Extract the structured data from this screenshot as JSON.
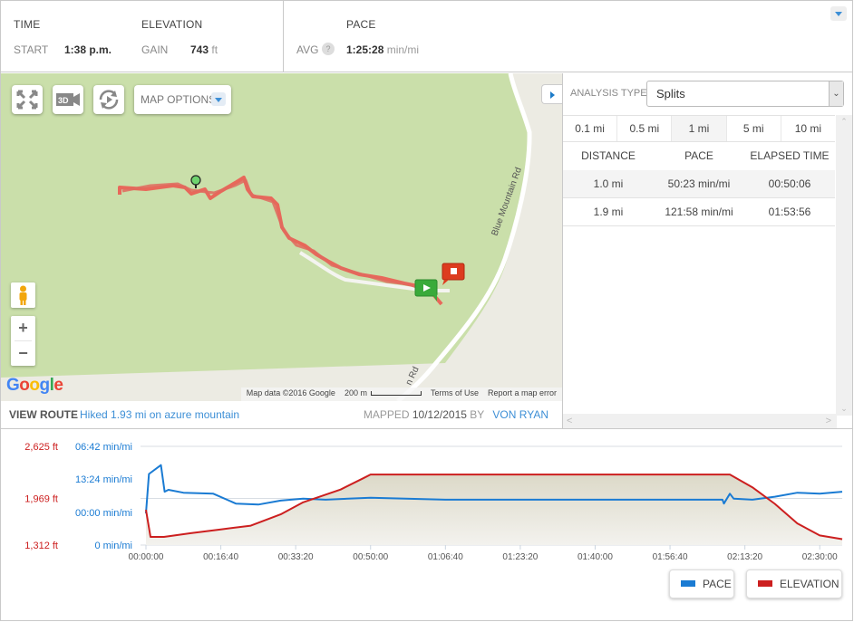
{
  "stats": {
    "time": {
      "label": "TIME",
      "sub": "START",
      "value": "1:38 p.m."
    },
    "elevation": {
      "label": "ELEVATION",
      "sub": "GAIN",
      "value": "743",
      "unit": "ft"
    },
    "pace": {
      "label": "PACE",
      "sub": "AVG",
      "help": "?",
      "value": "1:25:28",
      "unit": "min/mi"
    }
  },
  "map": {
    "controls": {
      "fullscreen_icon": "fullscreen-icon",
      "view3d_icon": "3d-camera-icon",
      "rotate_icon": "rotate-icon",
      "options_label": "MAP OPTIONS"
    },
    "zoom_in": "+",
    "zoom_out": "−",
    "road_label": "Blue Mountain Rd",
    "road_label_2": "n Rd",
    "google": [
      "G",
      "o",
      "o",
      "g",
      "l",
      "e"
    ],
    "footer": {
      "data": "Map data ©2016 Google",
      "scale": "200 m",
      "terms": "Terms of Use",
      "report": "Report a map error"
    }
  },
  "route": {
    "view_label": "VIEW ROUTE",
    "link": "Hiked 1.93 mi on azure mountain",
    "mapped_label": "MAPPED",
    "mapped_date": "10/12/2015",
    "by_label": "BY",
    "author": "VON RYAN"
  },
  "analysis": {
    "type_label": "ANALYSIS TYPE:",
    "type_value": "Splits",
    "tabs": [
      {
        "label": "0.1 mi",
        "active": false
      },
      {
        "label": "0.5 mi",
        "active": false
      },
      {
        "label": "1 mi",
        "active": true
      },
      {
        "label": "5 mi",
        "active": false
      },
      {
        "label": "10 mi",
        "active": false
      }
    ],
    "columns": [
      "DISTANCE",
      "PACE",
      "ELAPSED TIME"
    ],
    "rows": [
      [
        "1.0 mi",
        "50:23 min/mi",
        "00:50:06"
      ],
      [
        "1.9 mi",
        "121:58 min/mi",
        "01:53:56"
      ]
    ]
  },
  "colors": {
    "pace": "#1a7bd3",
    "elevation": "#cc1f1f",
    "link": "#3d8fd6",
    "map_green": "#cadfaa",
    "route": "#e8685a"
  },
  "chart_data": {
    "type": "line",
    "title": "",
    "x_ticks": [
      "00:00:00",
      "00:16:40",
      "00:33:20",
      "00:50:00",
      "01:06:40",
      "01:23:20",
      "01:40:00",
      "01:56:40",
      "02:13:20",
      "02:30:00"
    ],
    "x_range_seconds": [
      0,
      9000
    ],
    "y_left_elevation_ticks": [
      "2,625 ft",
      "1,969 ft",
      "1,312 ft"
    ],
    "y_left_elevation_range": [
      1312,
      2625
    ],
    "y_pace_ticks": [
      "06:42 min/mi",
      "13:24 min/mi",
      "00:00 min/mi",
      "0 min/mi"
    ],
    "legend": [
      "PACE",
      "ELEVATION"
    ],
    "legend_position": "bottom-right",
    "series": [
      {
        "name": "ELEVATION",
        "unit": "ft",
        "x_seconds": [
          0,
          60,
          240,
          600,
          1000,
          1400,
          1800,
          2100,
          2600,
          2900,
          3000,
          4500,
          6000,
          7700,
          7800,
          8100,
          8400,
          8700,
          9000,
          9300
        ],
        "values": [
          1780,
          1420,
          1420,
          1470,
          1520,
          1570,
          1720,
          1880,
          2050,
          2200,
          2250,
          2250,
          2250,
          2250,
          2250,
          2080,
          1860,
          1600,
          1440,
          1390
        ]
      },
      {
        "name": "PACE",
        "unit": "normalized (0=bottom,1=top)",
        "x_seconds": [
          0,
          40,
          200,
          250,
          300,
          500,
          900,
          1200,
          1500,
          1800,
          2100,
          2400,
          3000,
          4000,
          5000,
          6000,
          7700,
          7720,
          7800,
          7850,
          8100,
          8400,
          8700,
          9000,
          9300
        ],
        "values": [
          0.32,
          0.72,
          0.81,
          0.54,
          0.56,
          0.53,
          0.52,
          0.42,
          0.41,
          0.45,
          0.47,
          0.46,
          0.48,
          0.46,
          0.46,
          0.46,
          0.46,
          0.42,
          0.52,
          0.47,
          0.46,
          0.49,
          0.53,
          0.52,
          0.54
        ]
      }
    ]
  }
}
